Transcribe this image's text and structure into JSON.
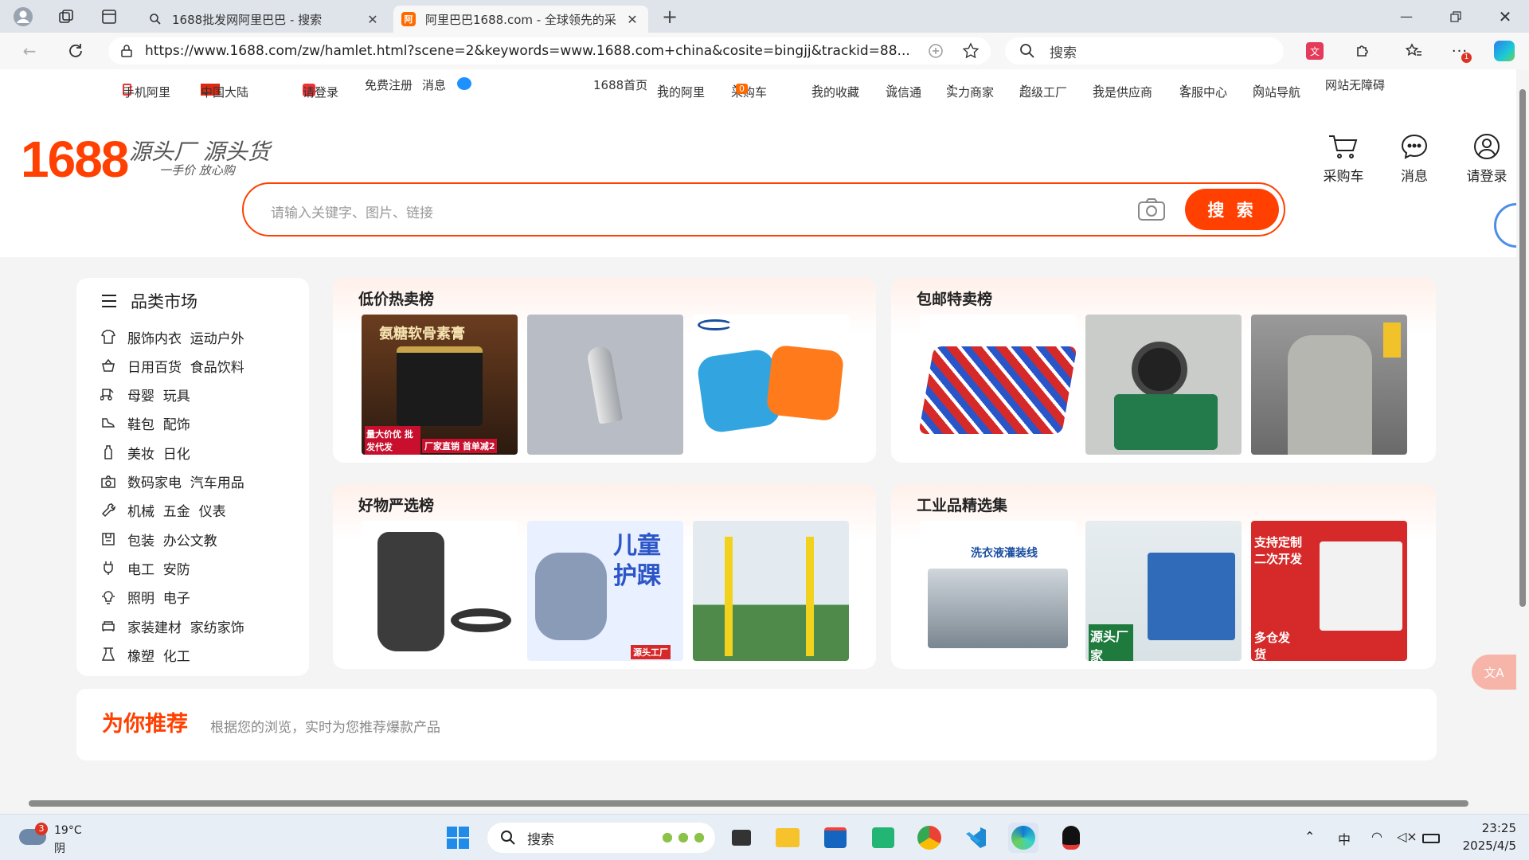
{
  "browser": {
    "tabs": [
      {
        "title": "1688批发网阿里巴巴 - 搜索",
        "active": false
      },
      {
        "title": "阿里巴巴1688.com - 全球领先的采",
        "active": true
      }
    ],
    "url": "https://www.1688.com/zw/hamlet.html?scene=2&keywords=www.1688.com+china&cosite=bingjj&trackid=88...",
    "search_placeholder": "搜索",
    "notification_badge": "1"
  },
  "topnav": {
    "left": [
      "手机阿里",
      "中国大陆",
      "请登录",
      "免费注册",
      "消息"
    ],
    "right": [
      "1688首页",
      "我的阿里",
      "采购车",
      "我的收藏",
      "诚信通",
      "实力商家",
      "超级工厂",
      "我是供应商",
      "客服中心",
      "网站导航",
      "网站无障碍"
    ],
    "cart_count": "0"
  },
  "header": {
    "logo": "1688",
    "slogan": "源头厂 源头货",
    "slogan_sub": "一手价 放心购",
    "search_placeholder": "请输入关键字、图片、链接",
    "search_button": "搜 索",
    "icons": [
      {
        "label": "采购车",
        "icon": "cart-icon"
      },
      {
        "label": "消息",
        "icon": "message-icon"
      },
      {
        "label": "请登录",
        "icon": "user-icon"
      }
    ]
  },
  "categories": {
    "title": "品类市场",
    "items": [
      {
        "label": "服饰内衣  运动户外",
        "icon": "shirt-icon"
      },
      {
        "label": "日用百货  食品饮料",
        "icon": "basket-icon"
      },
      {
        "label": "母婴  玩具",
        "icon": "stroller-icon"
      },
      {
        "label": "鞋包  配饰",
        "icon": "shoe-icon"
      },
      {
        "label": "美妆  日化",
        "icon": "bottle-icon"
      },
      {
        "label": "数码家电  汽车用品",
        "icon": "camera-icon"
      },
      {
        "label": "机械  五金  仪表",
        "icon": "wrench-icon"
      },
      {
        "label": "包装  办公文教",
        "icon": "box-icon"
      },
      {
        "label": "电工  安防",
        "icon": "plug-icon"
      },
      {
        "label": "照明  电子",
        "icon": "bulb-icon"
      },
      {
        "label": "家装建材  家纺家饰",
        "icon": "sofa-icon"
      },
      {
        "label": "橡塑  化工",
        "icon": "flask-icon"
      }
    ]
  },
  "sections": [
    {
      "title": "低价热卖榜",
      "products": [
        {
          "desc": "ointment jar",
          "tag1": "氨糖软骨素膏",
          "tag2": "量大价优 批发代发",
          "tag3": "厂家直销 首单减2"
        },
        {
          "desc": "grey plastic cone"
        },
        {
          "desc": "swim arm floats"
        }
      ]
    },
    {
      "title": "包邮特卖榜",
      "products": [
        {
          "desc": "inflatable water slide"
        },
        {
          "desc": "circuit board speaker"
        },
        {
          "desc": "grey tank top"
        }
      ]
    },
    {
      "title": "好物严选榜",
      "products": [
        {
          "desc": "black plastic fitting"
        },
        {
          "desc": "ankle brace",
          "tag1": "儿童",
          "tag2": "护踝",
          "tag3": "源头工厂"
        },
        {
          "desc": "yellow net posts"
        }
      ]
    },
    {
      "title": "工业品精选集",
      "products": [
        {
          "desc": "liquid filling line",
          "tag1": "洗衣液灌装线"
        },
        {
          "desc": "melting furnace",
          "tag1": "源头厂家"
        },
        {
          "desc": "laser marking machine",
          "tag1": "支持定制 二次开发",
          "tag2": "多仓发货"
        }
      ]
    }
  ],
  "recommend": {
    "title": "为你推荐",
    "subtitle": "根据您的浏览，实时为您推荐爆款产品"
  },
  "taskbar": {
    "weather_temp": "19°C",
    "weather_desc": "阴",
    "weather_badge": "3",
    "search_label": "搜索",
    "ime": "中",
    "time": "23:25",
    "date": "2025/4/5"
  }
}
